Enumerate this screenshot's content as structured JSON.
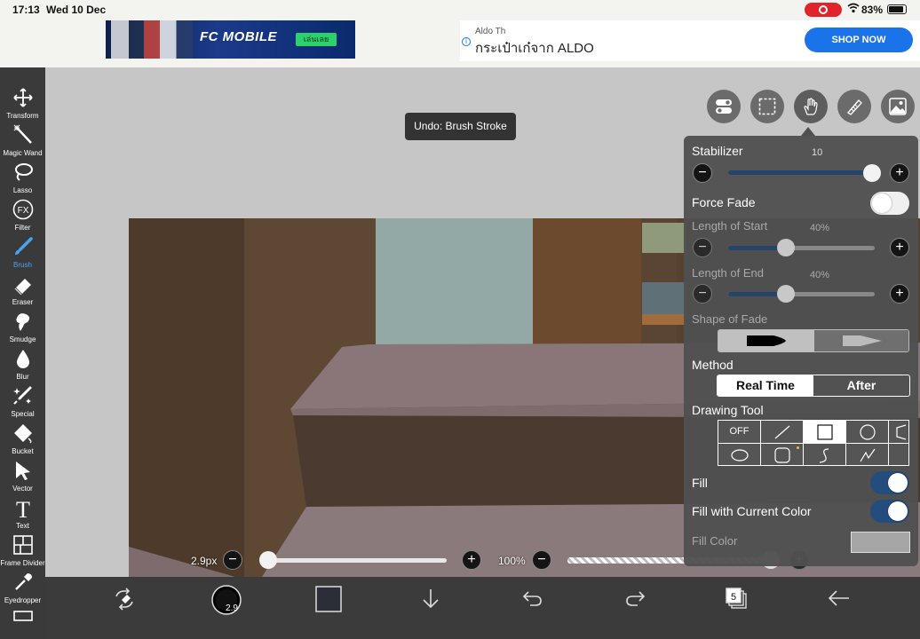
{
  "status_bar": {
    "time": "17:13",
    "date": "Wed 10 Dec",
    "battery": "83%"
  },
  "ads": {
    "left": {
      "logo": "FC MOBILE",
      "cta": "เล่นเลย"
    },
    "right": {
      "brand": "Aldo Th",
      "headline": "กระเป๋าเก๋จาก ALDO",
      "button": "SHOP NOW"
    }
  },
  "left_toolbar": {
    "items": [
      {
        "label": "Transform",
        "icon": "move-icon"
      },
      {
        "label": "Magic Wand",
        "icon": "magic-wand-icon"
      },
      {
        "label": "Lasso",
        "icon": "lasso-icon"
      },
      {
        "label": "Filter",
        "icon": "fx-icon"
      },
      {
        "label": "Brush",
        "icon": "brush-icon",
        "active": true
      },
      {
        "label": "Eraser",
        "icon": "eraser-icon"
      },
      {
        "label": "Smudge",
        "icon": "smudge-icon"
      },
      {
        "label": "Blur",
        "icon": "drop-icon"
      },
      {
        "label": "Special",
        "icon": "special-icon"
      },
      {
        "label": "Bucket",
        "icon": "bucket-icon"
      },
      {
        "label": "Vector",
        "icon": "cursor-icon"
      },
      {
        "label": "Text",
        "icon": "text-icon"
      },
      {
        "label": "Frame Divider",
        "icon": "frame-divider-icon"
      },
      {
        "label": "Eyedropper",
        "icon": "eyedropper-icon"
      }
    ]
  },
  "toast": {
    "text": "Undo: Brush Stroke"
  },
  "top_tools": [
    "toggle-icon",
    "selection-icon",
    "hand-icon",
    "ruler-icon",
    "image-icon"
  ],
  "panel": {
    "stabilizer": {
      "label": "Stabilizer",
      "value": "10",
      "level": 1.0
    },
    "force_fade": {
      "label": "Force Fade",
      "on": false
    },
    "length_start": {
      "label": "Length of Start",
      "value": "40%",
      "level": 0.4
    },
    "length_end": {
      "label": "Length of End",
      "value": "40%",
      "level": 0.4
    },
    "shape_of_fade": {
      "label": "Shape of Fade"
    },
    "method": {
      "label": "Method",
      "options": [
        "Real Time",
        "After"
      ],
      "selected": "Real Time"
    },
    "drawing_tool": {
      "label": "Drawing Tool",
      "cells": [
        "OFF",
        "line-icon",
        "rectangle-icon",
        "circle-icon",
        "polygon-icon",
        "ellipse-icon",
        "rounded-rect-icon",
        "curve-icon",
        "polyline-icon"
      ],
      "selected": "rectangle-icon"
    },
    "fill": {
      "label": "Fill",
      "on": true
    },
    "fill_current": {
      "label": "Fill with Current Color",
      "on": true
    },
    "fill_color": {
      "label": "Fill Color",
      "value": "#a6a6a6"
    }
  },
  "bottom_sliders": {
    "brush_size": "2.9px",
    "opacity": "100%"
  },
  "bottom_bar": {
    "brush_badge": "2.9",
    "layer_count": "5",
    "icons": [
      "swap-icon",
      "brush-size-icon",
      "color-swatch-icon",
      "download-icon",
      "undo-icon",
      "redo-icon",
      "layers-icon",
      "back-icon"
    ]
  },
  "colors": {
    "accent": "#4aa3f0",
    "toggle_on": "#244c7c",
    "primary_color": "#2b2e36"
  }
}
